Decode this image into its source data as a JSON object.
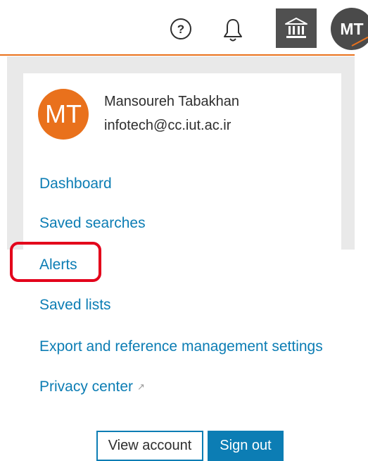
{
  "header": {
    "help_icon": "help-circle-icon",
    "notifications_icon": "bell-icon",
    "institution_icon": "institution-icon",
    "avatar_initials": "MT"
  },
  "profile": {
    "initials": "MT",
    "name": "Mansoureh Tabakhan",
    "email": "infotech@cc.iut.ac.ir"
  },
  "menu": {
    "dashboard": "Dashboard",
    "saved_searches": "Saved searches",
    "alerts": "Alerts",
    "saved_lists": "Saved lists",
    "export_settings": "Export and reference management settings",
    "privacy_center": "Privacy center",
    "privacy_external_icon": "external-link-icon"
  },
  "actions": {
    "view_account": "View account",
    "sign_out": "Sign out"
  },
  "colors": {
    "accent_orange": "#e9711c",
    "link_blue": "#0c7db4",
    "highlight_red": "#e3001b",
    "avatar_dark": "#4a4a4a"
  }
}
